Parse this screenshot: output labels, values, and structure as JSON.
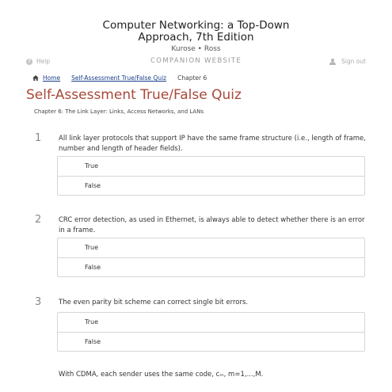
{
  "book": {
    "title_line1": "Computer Networking: a Top-Down",
    "title_line2": "Approach, 7th Edition",
    "authors": "Kurose • Ross"
  },
  "topbar": {
    "help_label": "Help",
    "site_label": "COMPANION WEBSITE",
    "signout_label": "Sign out"
  },
  "breadcrumb": {
    "home": "Home",
    "quiz": "Self-Assessment True/False Quiz",
    "current": "Chapter 6"
  },
  "page": {
    "title": "Self-Assessment True/False Quiz",
    "subtitle": "Chapter 6: The Link Layer: Links, Access Networks, and LANs"
  },
  "questions": [
    {
      "number": "1",
      "text": "All link layer protocols that support IP have the same frame structure (i.e., length of frame, number and length of header fields).",
      "options": [
        "True",
        "False"
      ]
    },
    {
      "number": "2",
      "text": "CRC error detection, as used in Ethernet, is always able to detect whether there is an error in a frame.",
      "options": [
        "True",
        "False"
      ]
    },
    {
      "number": "3",
      "text": "The even parity bit scheme can correct single bit errors.",
      "options": [
        "True",
        "False"
      ]
    }
  ],
  "partial_question": "With CDMA, each sender uses the same code, cₘ, m=1,...,M."
}
